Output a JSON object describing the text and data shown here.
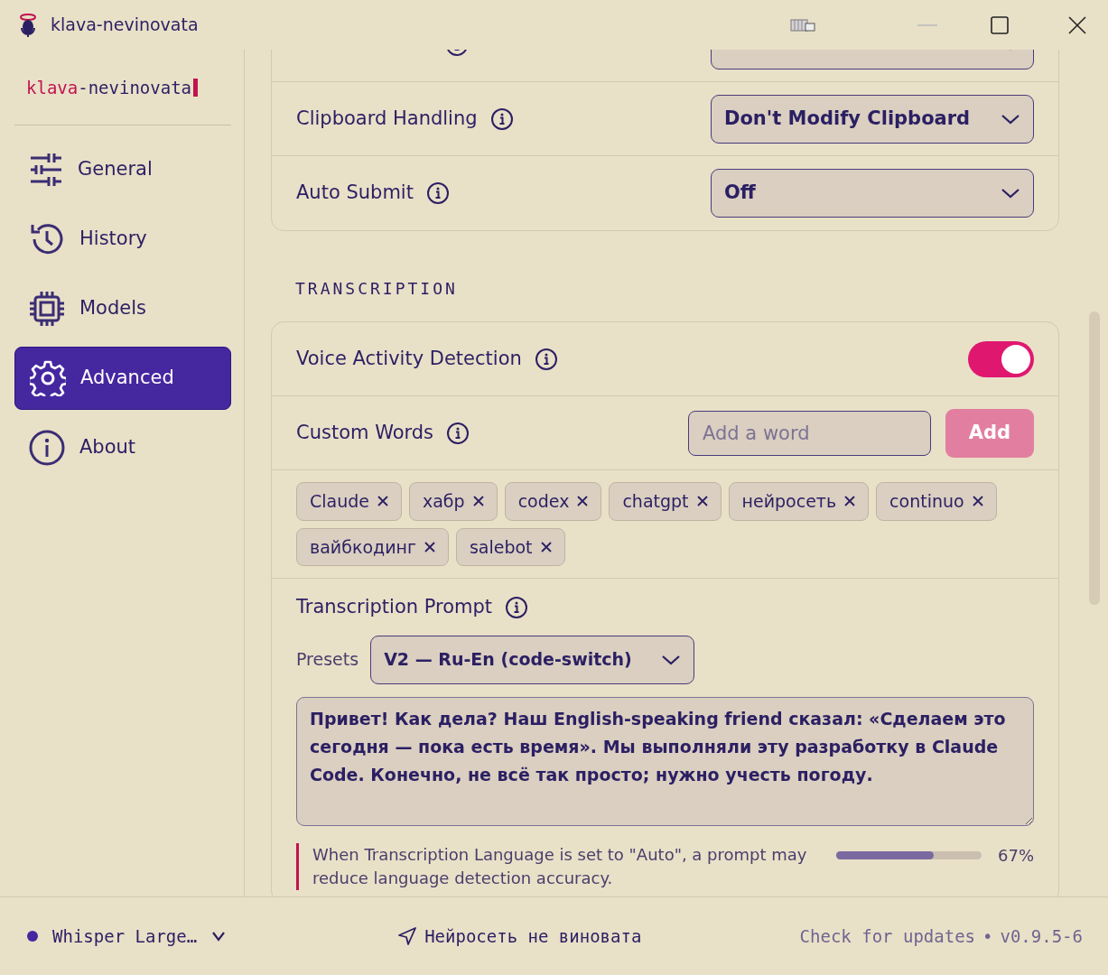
{
  "window": {
    "title": "klava-nevinovata"
  },
  "sidebar": {
    "brand_accent": "klava",
    "brand_rest": "-nevinovata",
    "items": [
      {
        "label": "General",
        "selected": false
      },
      {
        "label": "History",
        "selected": false
      },
      {
        "label": "Models",
        "selected": false
      },
      {
        "label": "Advanced",
        "selected": true
      },
      {
        "label": "About",
        "selected": false
      }
    ]
  },
  "output_settings_cut_row": true,
  "output_settings": [
    {
      "label": "Clipboard Handling",
      "value": "Don't Modify Clipboard"
    },
    {
      "label": "Auto Submit",
      "value": "Off"
    }
  ],
  "transcription": {
    "heading": "TRANSCRIPTION",
    "voice_activity_detection": {
      "label": "Voice Activity Detection",
      "on": true
    },
    "custom_words": {
      "label": "Custom Words",
      "placeholder": "Add a word",
      "add_button": "Add",
      "words": [
        "Claude",
        "хабр",
        "codex",
        "chatgpt",
        "нейросеть",
        "continuo",
        "вайбкодинг",
        "salebot"
      ]
    },
    "prompt": {
      "label": "Transcription Prompt",
      "presets_label": "Presets",
      "preset": "V2 — Ru-En (code-switch)",
      "text": "Привет! Как дела? Наш English-speaking friend сказал: «Сделаем это сегодня — пока есть время». Мы выполняли эту разработку в Claude Code. Конечно, не всё так просто; нужно учесть погоду.",
      "note": "When Transcription Language is set to \"Auto\", a prompt may reduce language detection accuracy.",
      "level": 0.67,
      "reading": "67%"
    }
  },
  "footer": {
    "model": "Whisper Large…",
    "tagline": "Нейросеть не виновата",
    "check_updates": "Check for updates",
    "separator": "•",
    "version": "v0.9.5-6"
  }
}
